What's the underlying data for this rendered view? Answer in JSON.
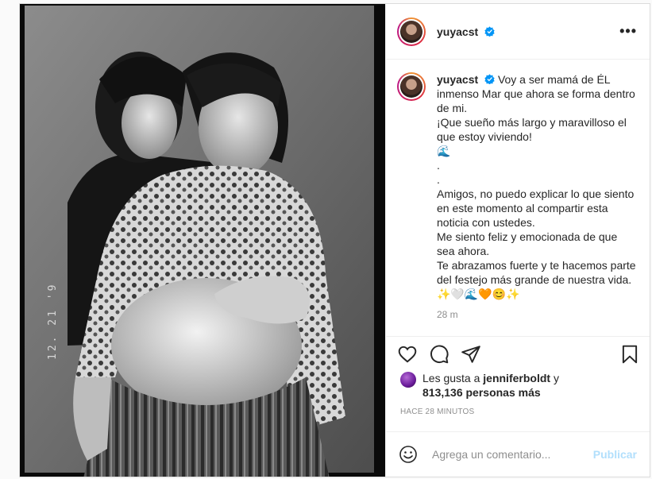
{
  "post": {
    "username": "yuyacst",
    "photo": {
      "date_stamp": "12. 21 '9"
    },
    "caption": {
      "lines": [
        "Voy a ser mamá de ÉL inmenso Mar que ahora se forma dentro de mi.",
        "¡Que sueño más largo y maravilloso el que estoy viviendo!",
        "🌊",
        ".",
        ".",
        "Amigos, no puedo explicar lo que siento en este momento al compartir esta noticia con ustedes.",
        "Me siento feliz y emocionada de que sea ahora.",
        "Te abrazamos fuerte y te hacemos parte del festejo más grande de nuestra vida.",
        "✨🤍🌊🧡😊✨"
      ],
      "time": "28 m"
    },
    "likes": {
      "prefix": "Les gusta a",
      "liker": "jenniferboldt",
      "conj": "y",
      "count_text": "813,136 personas más"
    },
    "timestamp": "Hace 28 minutos",
    "comment": {
      "placeholder": "Agrega un comentario...",
      "post_label": "Publicar"
    }
  },
  "colors": {
    "verified": "#0095f6",
    "publish_disabled": "#b2dffc"
  },
  "icons": [
    "verified-badge-icon",
    "more-options-icon",
    "heart-icon",
    "comment-icon",
    "share-icon",
    "bookmark-icon",
    "emoji-icon"
  ]
}
